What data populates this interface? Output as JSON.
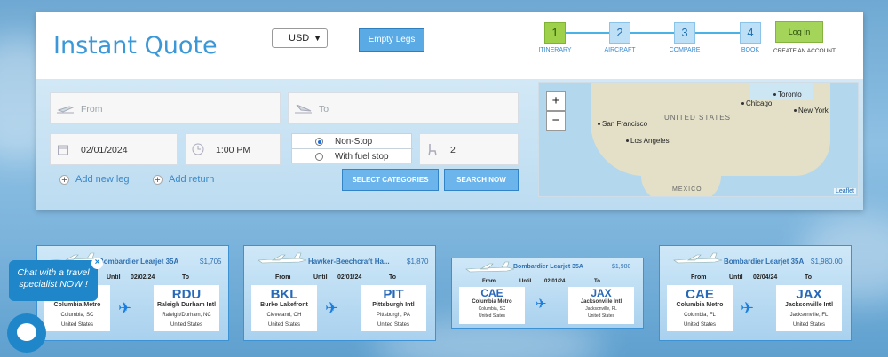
{
  "header": {
    "title": "Instant Quote",
    "currency": "USD",
    "empty_legs_label": "Empty Legs",
    "login_label": "Log in",
    "create_account_label": "CREATE AN ACCOUNT"
  },
  "steps": [
    {
      "num": "1",
      "label": "ITINERARY"
    },
    {
      "num": "2",
      "label": "AIRCRAFT"
    },
    {
      "num": "3",
      "label": "COMPARE"
    },
    {
      "num": "4",
      "label": "BOOK"
    }
  ],
  "form": {
    "from_placeholder": "From",
    "to_placeholder": "To",
    "date": "02/01/2024",
    "time": "1:00 PM",
    "nonstop_label": "Non-Stop",
    "fuelstop_label": "With fuel stop",
    "passengers": "2",
    "add_leg_label": "Add new leg",
    "add_return_label": "Add return",
    "select_categories_label": "SELECT CATEGORIES",
    "search_label": "SEARCH NOW"
  },
  "map": {
    "zoom_in": "+",
    "zoom_out": "−",
    "country_label": "UNITED STATES",
    "mexico_label": "MEXICO",
    "attribution": "Leaflet",
    "cities": [
      "Toronto",
      "Chicago",
      "New York",
      "San Francisco",
      "Los Angeles"
    ]
  },
  "empty_legs": [
    {
      "aircraft": "Bombardier Learjet 35A",
      "price": "$1,705",
      "from_hdr": "From",
      "until_hdr": "Until",
      "date": "02/02/24",
      "to_hdr": "To",
      "from_code": "",
      "from_name": "Columbia Metro",
      "from_city": "Columbia, SC",
      "from_country": "United States",
      "to_code": "RDU",
      "to_name": "Raleigh Durham Intl",
      "to_city": "Raleigh/Durham, NC",
      "to_country": "United States"
    },
    {
      "aircraft": "Hawker-Beechcraft Ha...",
      "price": "$1,870",
      "from_hdr": "From",
      "until_hdr": "Until",
      "date": "02/01/24",
      "to_hdr": "To",
      "from_code": "BKL",
      "from_name": "Burke Lakefront",
      "from_city": "Cleveland, OH",
      "from_country": "United States",
      "to_code": "PIT",
      "to_name": "Pittsburgh Intl",
      "to_city": "Pittsburgh, PA",
      "to_country": "United States"
    },
    {
      "aircraft": "Bombardier Learjet 35A",
      "price": "$1,980",
      "from_hdr": "From",
      "until_hdr": "Until",
      "date": "02/01/24",
      "to_hdr": "To",
      "from_code": "CAE",
      "from_name": "Columbia Metro",
      "from_city": "Columbia, SC",
      "from_country": "United States",
      "to_code": "JAX",
      "to_name": "Jacksonville Intl",
      "to_city": "Jacksonville, FL",
      "to_country": "United States"
    },
    {
      "aircraft": "Bombardier Learjet 35A",
      "price": "$1,980.00",
      "from_hdr": "From",
      "until_hdr": "Until",
      "date": "02/04/24",
      "to_hdr": "To",
      "from_code": "CAE",
      "from_name": "Columbia Metro",
      "from_city": "Columbia, FL",
      "from_country": "United States",
      "to_code": "JAX",
      "to_name": "Jacksonville Intl",
      "to_city": "Jacksonville, FL",
      "to_country": "United States"
    }
  ],
  "chat": {
    "text": "Chat with a travel specialist NOW !",
    "close": "×"
  }
}
